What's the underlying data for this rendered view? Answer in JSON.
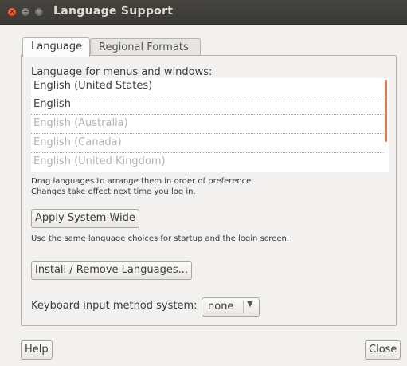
{
  "window": {
    "title": "Language Support"
  },
  "tabs": [
    {
      "label": "Language",
      "active": true
    },
    {
      "label": "Regional Formats",
      "active": false
    }
  ],
  "language": {
    "heading": "Language for menus and windows:",
    "items": [
      {
        "label": "English (United States)",
        "enabled": true
      },
      {
        "label": "English",
        "enabled": true
      },
      {
        "label": "English (Australia)",
        "enabled": false
      },
      {
        "label": "English (Canada)",
        "enabled": false
      },
      {
        "label": "English (United Kingdom)",
        "enabled": false
      }
    ],
    "hint_line1": "Drag languages to arrange them in order of preference.",
    "hint_line2": "Changes take effect next time you log in.",
    "apply_button": "Apply System-Wide",
    "apply_hint": "Use the same language choices for startup and the login screen.",
    "install_button": "Install / Remove Languages...",
    "keyboard_label": "Keyboard input method system:",
    "keyboard_value": "none"
  },
  "footer": {
    "help_button": "Help",
    "close_button": "Close"
  },
  "colors": {
    "accent": "#e07a54",
    "titlebar": "#3f3e39"
  }
}
